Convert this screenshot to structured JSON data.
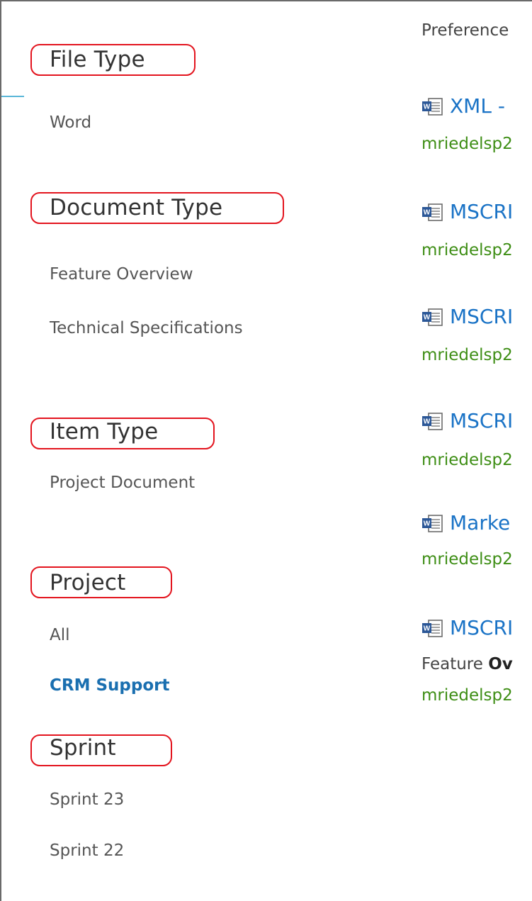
{
  "refiners": {
    "file_type": {
      "heading": "File Type",
      "values": [
        "Word"
      ]
    },
    "document_type": {
      "heading": "Document Type",
      "values": [
        "Feature Overview",
        "Technical Specifications"
      ]
    },
    "item_type": {
      "heading": "Item Type",
      "values": [
        "Project Document"
      ]
    },
    "project": {
      "heading": "Project",
      "values": [
        "All",
        "CRM Support"
      ],
      "selected": "CRM Support"
    },
    "sprint": {
      "heading": "Sprint",
      "values": [
        "Sprint 23",
        "Sprint 22"
      ]
    }
  },
  "results": {
    "preference_text": "Preference",
    "items": [
      {
        "icon": "word-doc-icon",
        "title": "XML -",
        "url": "mriedelsp2"
      },
      {
        "icon": "word-doc-icon",
        "title": "MSCRI",
        "url": "mriedelsp2"
      },
      {
        "icon": "word-doc-icon",
        "title": "MSCRI",
        "url": "mriedelsp2"
      },
      {
        "icon": "word-doc-icon",
        "title": "MSCRI",
        "url": "mriedelsp2"
      },
      {
        "icon": "word-doc-icon",
        "title": "Marke",
        "url": "mriedelsp2"
      },
      {
        "icon": "word-doc-icon",
        "title": "MSCRI",
        "snippet_plain": "Feature ",
        "snippet_bold": "Ov",
        "url": "mriedelsp2"
      }
    ]
  },
  "colors": {
    "highlight_box": "#e3141e",
    "link_blue": "#1a73c6",
    "url_green": "#3e8e15",
    "selected_refiner": "#1a6fb0",
    "frame_accent": "#5ab6d8"
  }
}
